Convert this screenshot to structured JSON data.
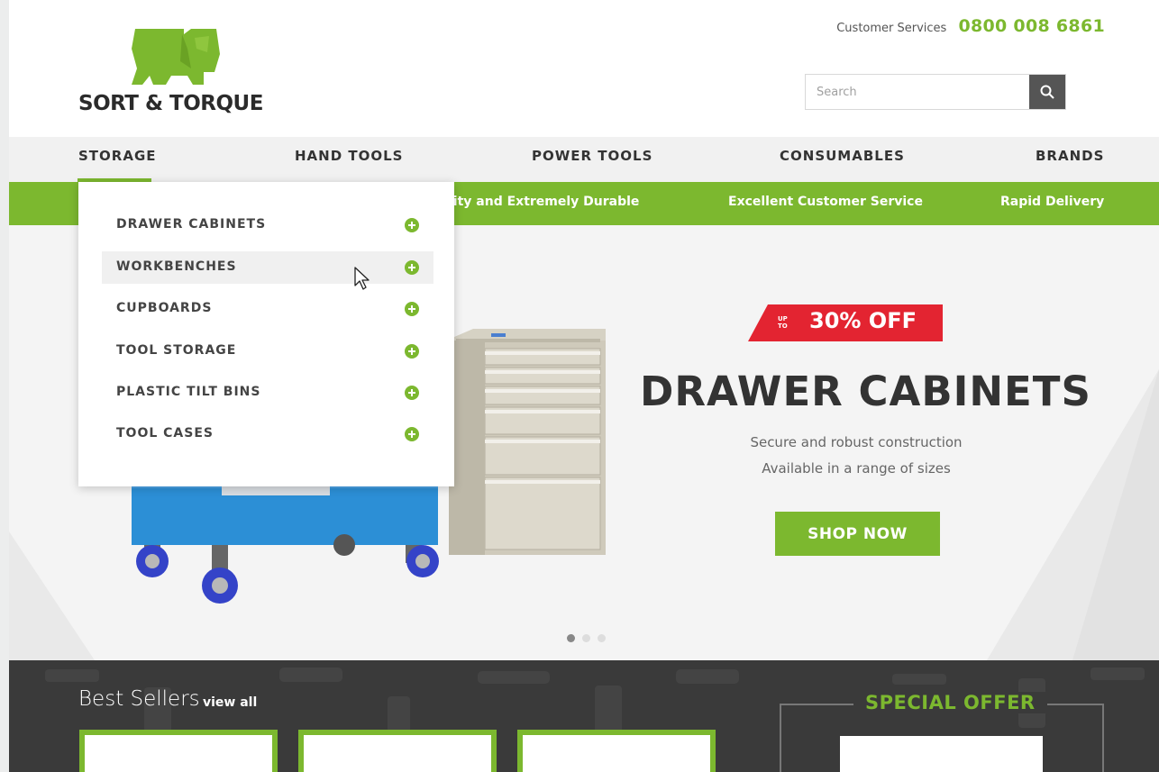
{
  "brand": {
    "name": "SORT & TORQUE",
    "accent_color": "#7cb82f",
    "dark_color": "#333333",
    "logo_icon": "elephant-icon"
  },
  "header": {
    "customer_services_label": "Customer Services",
    "phone": "0800 008 6861",
    "search_placeholder": "Search",
    "search_icon": "search-icon"
  },
  "nav": {
    "items": [
      {
        "label": "STORAGE"
      },
      {
        "label": "HAND TOOLS"
      },
      {
        "label": "POWER TOOLS"
      },
      {
        "label": "CONSUMABLES"
      },
      {
        "label": "BRANDS"
      }
    ],
    "active": "STORAGE"
  },
  "usp_bar": {
    "items": [
      "lity and Extremely Durable",
      "Excellent Customer Service",
      "Rapid Delivery"
    ]
  },
  "dropdown": {
    "items": [
      {
        "label": "DRAWER CABINETS"
      },
      {
        "label": "WORKBENCHES"
      },
      {
        "label": "CUPBOARDS"
      },
      {
        "label": "TOOL STORAGE"
      },
      {
        "label": "PLASTIC TILT BINS"
      },
      {
        "label": "TOOL CASES"
      }
    ],
    "hovered": "WORKBENCHES",
    "expand_icon": "plus-circle-icon"
  },
  "hero": {
    "badge_prefix": "UP TO",
    "badge": "30% OFF",
    "badge_color": "#e32431",
    "title": "DRAWER CABINETS",
    "subtitle_1": "Secure and robust construction",
    "subtitle_2": "Available in a range of sizes",
    "cta": "SHOP NOW",
    "slides": 3,
    "active_slide": 1
  },
  "best_sellers": {
    "title": "Best Sellers",
    "view_all": "view all"
  },
  "special_offer": {
    "title": "SPECIAL OFFER"
  }
}
